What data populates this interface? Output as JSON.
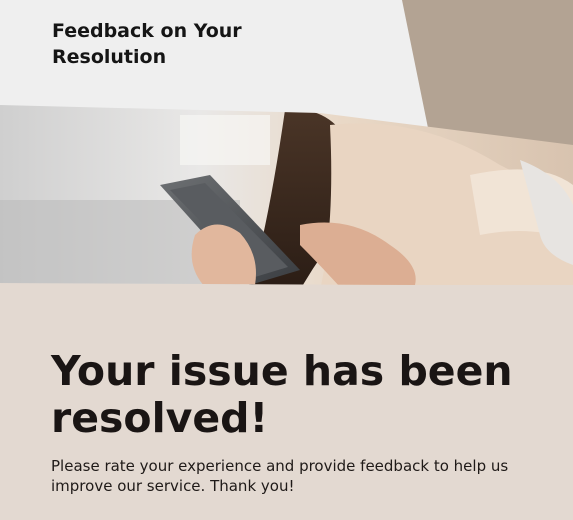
{
  "header": {
    "title": "Feedback on Your Resolution"
  },
  "hero": {
    "image_icon": "person-holding-phone-photo",
    "heading": "Your issue has been resolved!",
    "body": "Please rate your experience and provide feedback to help us improve our service. Thank you!"
  },
  "colors": {
    "header_bg": "#efefef",
    "accent_shape": "#b3a393",
    "page_bg": "#e3d9d1",
    "text_dark": "#1a1514"
  }
}
